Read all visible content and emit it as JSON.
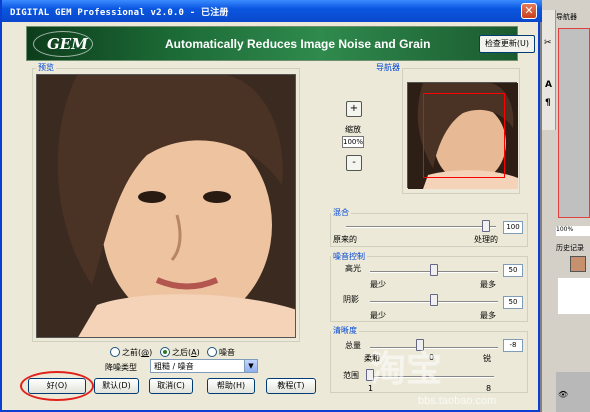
{
  "window": {
    "title": "DIGITAL GEM Professional  v2.0.0 - 已注册",
    "close_glyph": "✕"
  },
  "banner": {
    "logo_text": "GEM",
    "tagline": "Automatically Reduces Image Noise and Grain",
    "update_button": "检查更新(U)"
  },
  "preview": {
    "group_label": "预览"
  },
  "zoom": {
    "in": "+",
    "label": "缩放",
    "value": "100%",
    "out": "-"
  },
  "navigator": {
    "group_label": "导航器"
  },
  "blend": {
    "group_label": "混合",
    "left_label": "原来的",
    "right_label": "处理的",
    "value": "100",
    "level": 1.0
  },
  "noise": {
    "group_label": "噪音控制",
    "highlights_label": "高光",
    "highlights_value": "50",
    "highlights_level": 0.5,
    "shadows_label": "阴影",
    "shadows_value": "50",
    "shadows_level": 0.5,
    "min_label": "最少",
    "max_label": "最多"
  },
  "sharpness": {
    "group_label": "清晰度",
    "amount_label": "总量",
    "amount_value": "-8",
    "soft_label": "柔和",
    "zero_label": "0",
    "sharp_label": "锐",
    "range_label": "范围",
    "range_min": "1",
    "range_max": "8"
  },
  "view": {
    "before_label": "之前",
    "before_key": "@",
    "after_label": "之后",
    "after_key": "A",
    "noise_label": "噪音",
    "noise_type_label": "降噪类型",
    "noise_type_value": "粗糙 / 噪音"
  },
  "buttons": {
    "ok": "好(O)",
    "default": "默认(D)",
    "cancel": "取消(C)",
    "help": "帮助(H)",
    "tutorial": "教程(T)"
  },
  "side_panel": {
    "navigator_tab": "导航器",
    "zoom_value": "100%",
    "history_tab": "历史记录"
  },
  "watermark": {
    "text": "淘宝",
    "url": "bbs.taobao.com"
  }
}
